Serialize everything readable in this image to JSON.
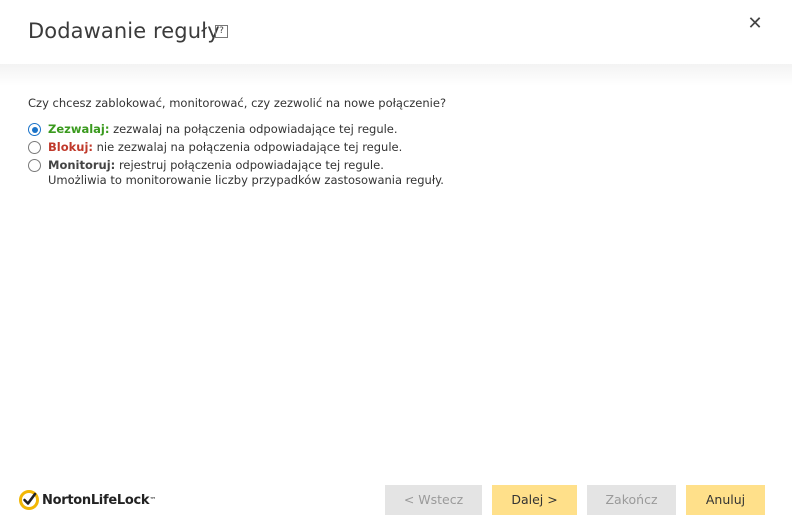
{
  "dialog": {
    "title": "Dodawanie reguły",
    "help_glyph": "?",
    "close_glyph": "✕"
  },
  "question": "Czy chcesz zablokować, monitorować, czy zezwolić na nowe połączenie?",
  "options": [
    {
      "label": "Zezwalaj:",
      "text": "zezwalaj na połączenia odpowiadające tej regule.",
      "selected": true,
      "color": "#3a9a1e"
    },
    {
      "label": "Blokuj:",
      "text": "nie zezwalaj na połączenia odpowiadające tej regule.",
      "selected": false,
      "color": "#c0392b"
    },
    {
      "label": "Monitoruj:",
      "text": "rejestruj połączenia odpowiadające tej regule.",
      "note": "Umożliwia to monitorowanie liczby przypadków zastosowania reguły.",
      "selected": false,
      "color": "#444444"
    }
  ],
  "brand": {
    "name": "NortonLifeLock",
    "tm": "™"
  },
  "buttons": {
    "back": "< Wstecz",
    "next": "Dalej >",
    "finish": "Zakończ",
    "cancel": "Anuluj"
  }
}
